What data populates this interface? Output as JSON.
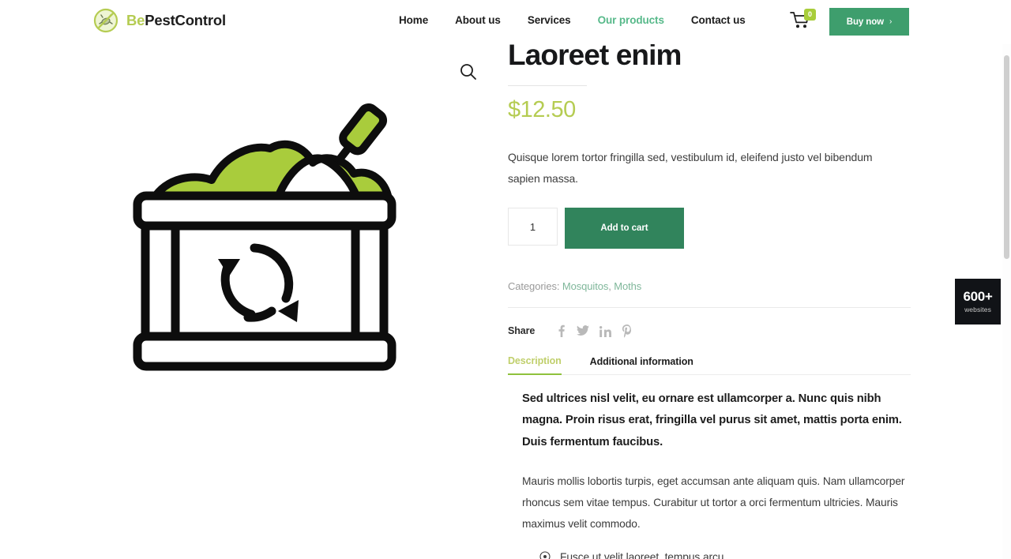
{
  "header": {
    "brand": {
      "prefix": "Be",
      "rest": "PestControl",
      "logo_icon": "no-bug-circle-icon"
    },
    "nav": [
      {
        "label": "Home",
        "active": false
      },
      {
        "label": "About us",
        "active": false
      },
      {
        "label": "Services",
        "active": false
      },
      {
        "label": "Our products",
        "active": true
      },
      {
        "label": "Contact us",
        "active": false
      }
    ],
    "cart": {
      "icon": "shopping-cart-icon",
      "count": "0"
    },
    "buy_now": {
      "label": "Buy now",
      "chevron": "›"
    },
    "colors": {
      "nav_active": "#57b98a",
      "buy_now_bg": "#3e9e6d",
      "cart_badge_bg": "#a8cd3a",
      "brand_accent": "#b5cc52"
    }
  },
  "gallery": {
    "zoom_icon": "magnifier-icon",
    "product_image_alt": "compost-bin-illustration"
  },
  "product": {
    "title": "Laoreet enim",
    "price": "$12.50",
    "price_color": "#b5cc52",
    "short_description": "Quisque lorem tortor fringilla sed, vestibulum id, eleifend justo vel bibendum sapien massa.",
    "quantity_value": "1",
    "quantity_placeholder": "1",
    "add_to_cart_label": "Add to cart",
    "add_to_cart_bg": "#31845c",
    "categories_label": "Categories:",
    "categories": [
      "Mosquitos",
      "Moths"
    ],
    "categories_separator": ", ",
    "share_label": "Share",
    "share_icons": [
      {
        "name": "facebook-icon",
        "glyph": "f"
      },
      {
        "name": "twitter-icon",
        "glyph": "t"
      },
      {
        "name": "linkedin-icon",
        "glyph": "in"
      },
      {
        "name": "pinterest-icon",
        "glyph": "p"
      }
    ]
  },
  "tabs": {
    "items": [
      {
        "label": "Description",
        "active": true
      },
      {
        "label": "Additional information",
        "active": false
      }
    ],
    "active_underline_color": "#8fc23c",
    "content": {
      "lead": "Sed ultrices nisl velit, eu ornare est ullamcorper a. Nunc quis nibh magna. Proin risus erat, fringilla vel purus sit amet, mattis porta enim. Duis fermentum faucibus.",
      "paragraph": "Mauris mollis lobortis turpis, eget accumsan ante aliquam quis. Nam ullamcorper rhoncus sem vitae tempus. Curabitur ut tortor a orci fermentum ultricies. Mauris maximus velit commodo.",
      "list": [
        "Fusce ut velit laoreet, tempus arcu"
      ]
    }
  },
  "side_badge": {
    "count": "600+",
    "label": "websites"
  }
}
